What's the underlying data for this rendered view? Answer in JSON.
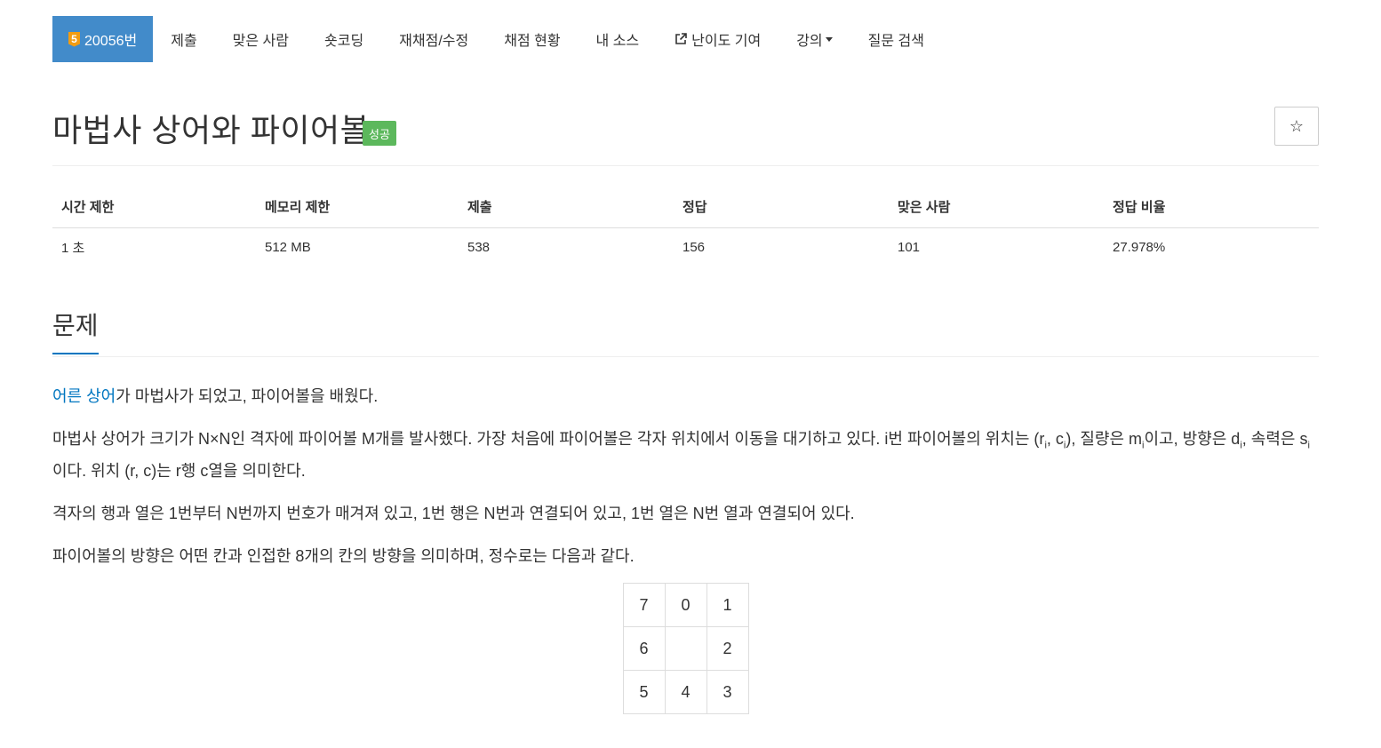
{
  "nav": {
    "problem_badge": "5",
    "problem_id": "20056번",
    "items": [
      "제출",
      "맞은 사람",
      "숏코딩",
      "재채점/수정",
      "채점 현황",
      "내 소스",
      "난이도 기여",
      "강의",
      "질문 검색"
    ]
  },
  "title": "마법사 상어와 파이어볼",
  "result_label": "성공",
  "star": "☆",
  "info_table": {
    "headers": [
      "시간 제한",
      "메모리 제한",
      "제출",
      "정답",
      "맞은 사람",
      "정답 비율"
    ],
    "values": [
      "1 초",
      "512 MB",
      "538",
      "156",
      "101",
      "27.978%"
    ]
  },
  "section_title": "문제",
  "problem": {
    "p1_link": "어른 상어",
    "p1_rest": "가 마법사가 되었고, 파이어볼을 배웠다.",
    "p2": {
      "a": "마법사 상어가 크기가 N×N인 격자에 파이어볼 M개를 발사했다. 가장 처음에 파이어볼은 각자 위치에서 이동을 대기하고 있다. i번 파이어볼의 위치는 (r",
      "sub_i": "i",
      "b": ", c",
      "c": "), 질량은 m",
      "d": "이고, 방향은 d",
      "e": ", 속력은 s",
      "f": "이다. 위치 (r, c)는 r행 c열을 의미한다."
    },
    "p3": "격자의 행과 열은 1번부터 N번까지 번호가 매겨져 있고, 1번 행은 N번과 연결되어 있고, 1번 열은 N번 열과 연결되어 있다.",
    "p4": "파이어볼의 방향은 어떤 칸과 인접한 8개의 칸의 방향을 의미하며, 정수로는 다음과 같다."
  },
  "direction_grid": [
    [
      "7",
      "0",
      "1"
    ],
    [
      "6",
      "",
      "2"
    ],
    [
      "5",
      "4",
      "3"
    ]
  ],
  "colors": {
    "nav_active": "#428bca",
    "success": "#5cb85c",
    "link": "#0076c0",
    "badge": "#f39c12"
  }
}
